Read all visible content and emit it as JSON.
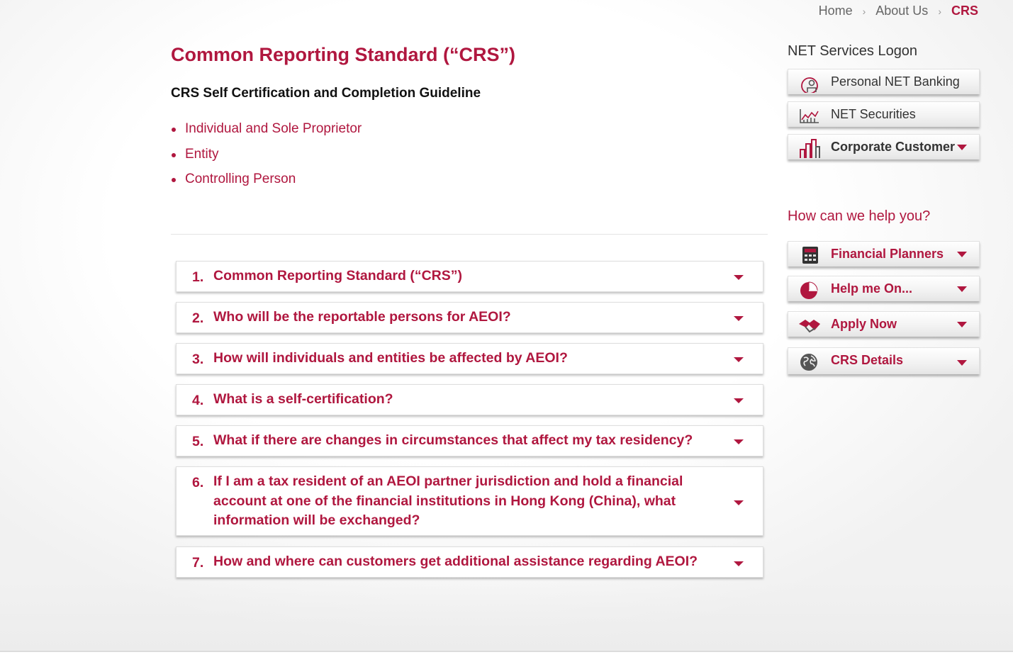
{
  "breadcrumb": {
    "home": "Home",
    "about": "About Us",
    "current": "CRS",
    "separator": "›"
  },
  "main": {
    "title": "Common Reporting Standard (“CRS”)",
    "subtitle": "CRS Self Certification and Completion Guideline",
    "guide_links": [
      "Individual and Sole Proprietor",
      "Entity",
      "Controlling Person"
    ],
    "faqs": [
      {
        "num": "1.",
        "question": "Common Reporting Standard (“CRS”)"
      },
      {
        "num": "2.",
        "question": "Who will be the reportable persons for AEOI?"
      },
      {
        "num": "3.",
        "question": "How will individuals and entities be affected by AEOI?"
      },
      {
        "num": "4.",
        "question": "What is a self-certification?"
      },
      {
        "num": "5.",
        "question": "What if there are changes in circumstances that affect my tax residency?"
      },
      {
        "num": "6.",
        "question": "If I am a tax resident of an AEOI partner jurisdiction and hold a financial account at one of the financial institutions in Hong Kong (China), what information will be exchanged?"
      },
      {
        "num": "7.",
        "question": "How and where can customers get additional assistance regarding AEOI?"
      }
    ]
  },
  "sidebar": {
    "logon_heading": "NET Services Logon",
    "logon_buttons": [
      {
        "label": "Personal NET Banking",
        "icon": "person-lock-icon"
      },
      {
        "label": "NET Securities",
        "icon": "stock-chart-icon"
      },
      {
        "label": "Corporate Customer",
        "icon": "building-icon"
      }
    ],
    "help_heading": "How can we help you?",
    "help_buttons": [
      {
        "label": "Financial Planners",
        "icon": "calculator-icon"
      },
      {
        "label": "Help me On...",
        "icon": "pie-chart-icon"
      },
      {
        "label": "Apply Now",
        "icon": "handshake-icon"
      },
      {
        "label": "CRS Details",
        "icon": "globe-icon"
      }
    ]
  },
  "colors": {
    "brand": "#b0173f",
    "text": "#333333"
  }
}
